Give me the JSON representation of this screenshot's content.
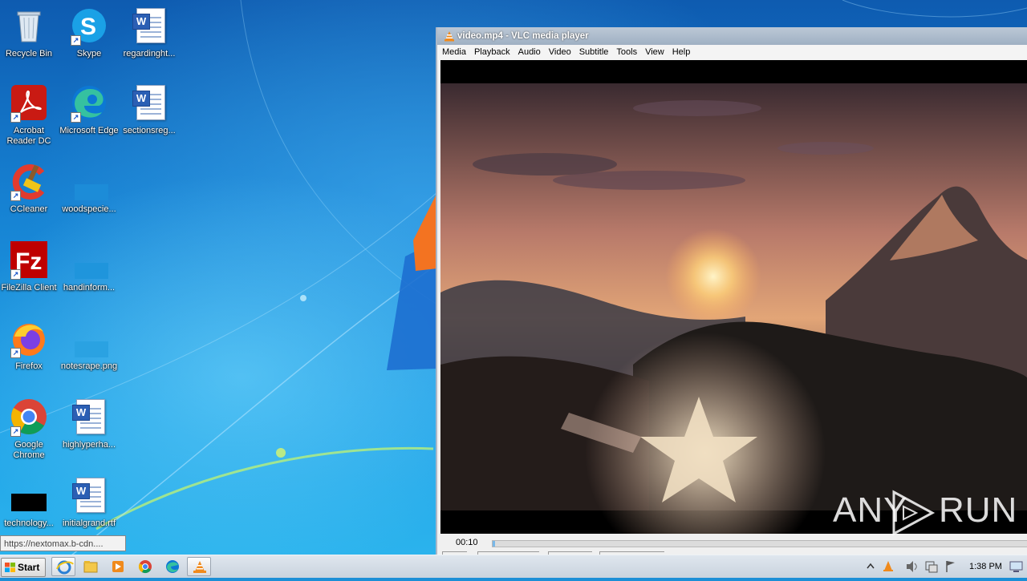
{
  "desktop": {
    "icons": [
      {
        "label": "Recycle Bin"
      },
      {
        "label": "Skype"
      },
      {
        "label": "regardinght..."
      },
      {
        "label": "Acrobat Reader DC"
      },
      {
        "label": "Microsoft Edge"
      },
      {
        "label": "sectionsreg..."
      },
      {
        "label": "CCleaner"
      },
      {
        "label": "woodspecie..."
      },
      {
        "label": "FileZilla Client"
      },
      {
        "label": "handinform..."
      },
      {
        "label": "Firefox"
      },
      {
        "label": "notesrape.png"
      },
      {
        "label": "Google Chrome"
      },
      {
        "label": "highlyperha..."
      },
      {
        "label": "technology..."
      },
      {
        "label": "initialgrand.rtf"
      }
    ]
  },
  "vlc": {
    "title": "video.mp4 - VLC media player",
    "menu": [
      "Media",
      "Playback",
      "Audio",
      "Video",
      "Subtitle",
      "Tools",
      "View",
      "Help"
    ],
    "elapsed": "00:10",
    "progress": 0.005
  },
  "watermark": {
    "left": "ANY",
    "right": "RUN"
  },
  "status_url": "https://nextomax.b-cdn....",
  "taskbar": {
    "start_label": "Start",
    "clock": "1:38 PM"
  },
  "colors": {
    "vlc_orange": "#f08a1c",
    "taskbar_bg": "#c9d3de",
    "wallpaper_blue": "#1681d2"
  }
}
